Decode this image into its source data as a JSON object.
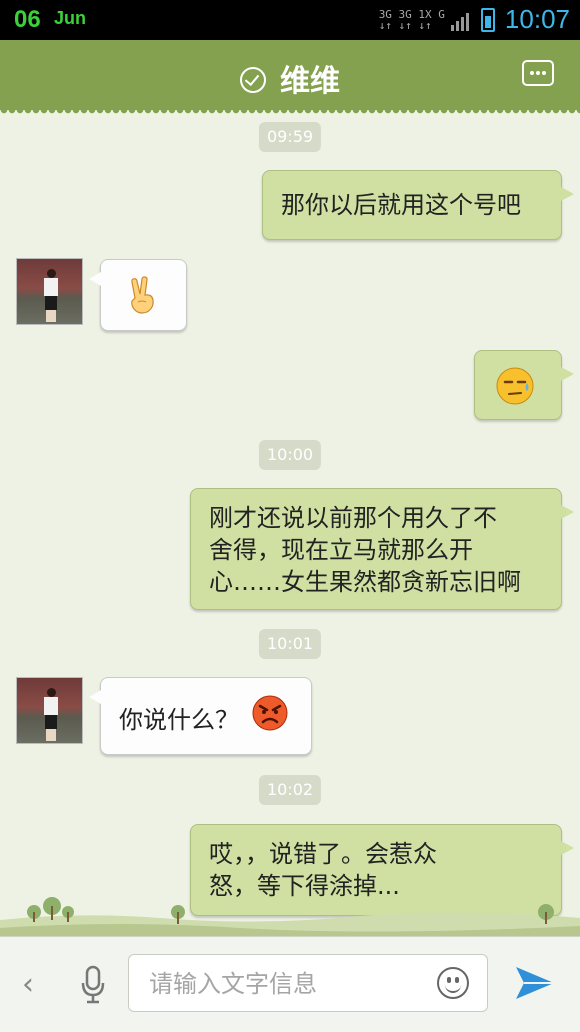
{
  "status_bar": {
    "day": "06",
    "month": "Jun",
    "network_top": "3G 3G 1X G",
    "network_bottom": "↓↑ ↓↑ ↓↑",
    "time": "10:07",
    "accent_color": "#3fb6e8",
    "date_color": "#3bd13b"
  },
  "header": {
    "title": "维维",
    "verified_icon": "check-circle-icon",
    "menu_icon": "more-dots-icon",
    "color": "#84a14f"
  },
  "messages": [
    {
      "type": "timestamp",
      "text": "09:59"
    },
    {
      "type": "text",
      "side": "right",
      "text": "那你以后就用这个号吧"
    },
    {
      "type": "emoji",
      "side": "left",
      "emoji": "victory-hand-icon"
    },
    {
      "type": "emoji",
      "side": "right",
      "emoji": "sweat-face-icon"
    },
    {
      "type": "timestamp",
      "text": "10:00"
    },
    {
      "type": "text",
      "side": "right",
      "lines": [
        "刚才还说以前那个用久了不",
        "舍得，现在立马就那么开",
        "心……女生果然都贪新忘旧啊"
      ]
    },
    {
      "type": "timestamp",
      "text": "10:01"
    },
    {
      "type": "text",
      "side": "left",
      "text": "你说什么？",
      "emoji": "angry-face-icon"
    },
    {
      "type": "timestamp",
      "text": "10:02"
    },
    {
      "type": "text",
      "side": "right",
      "lines": [
        "哎，，说错了。会惹众",
        "怒，等下得涂掉..."
      ]
    }
  ],
  "input_bar": {
    "placeholder": "请输入文字信息",
    "back_icon": "chevron-left-icon",
    "voice_icon": "microphone-icon",
    "emoji_icon": "smiley-icon",
    "send_icon": "send-plane-icon"
  },
  "colors": {
    "bubble_right": "#cfe0a2",
    "bubble_left": "#fdfdfd",
    "chat_bg": "#eef2e4"
  }
}
